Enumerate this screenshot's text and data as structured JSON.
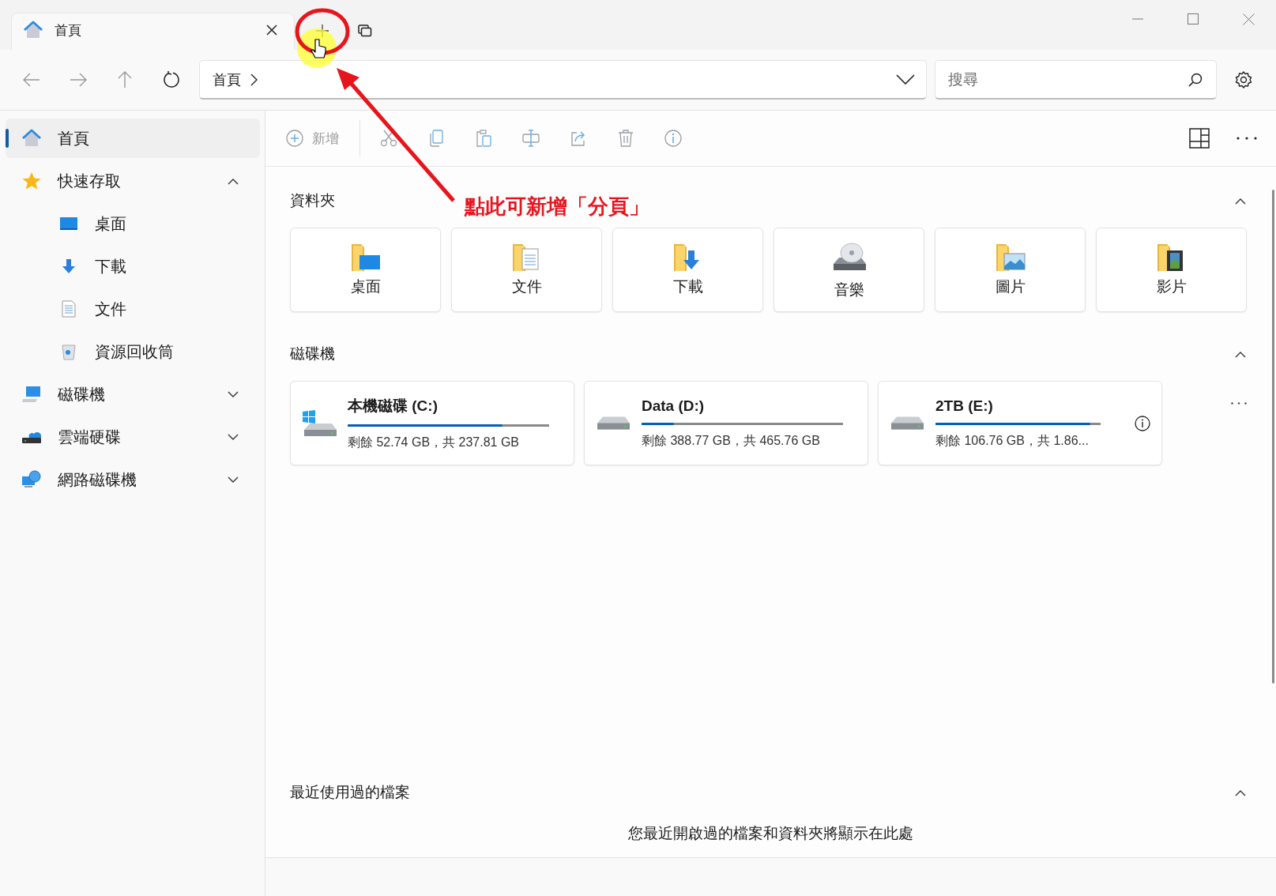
{
  "window": {
    "tabs": [
      {
        "label": "首頁",
        "selected": true
      }
    ]
  },
  "address_bar": {
    "breadcrumb": "首頁"
  },
  "search": {
    "placeholder": "搜尋"
  },
  "sidebar": {
    "items": [
      {
        "label": "首頁",
        "kind": "home",
        "selected": true
      },
      {
        "label": "快速存取",
        "kind": "star",
        "selected": false,
        "expanded": true,
        "children": [
          {
            "label": "桌面",
            "kind": "desktop",
            "selected": false
          },
          {
            "label": "下載",
            "kind": "download",
            "selected": false
          },
          {
            "label": "文件",
            "kind": "document",
            "selected": false
          },
          {
            "label": "資源回收筒",
            "kind": "recycle",
            "selected": false
          }
        ]
      },
      {
        "label": "磁碟機",
        "kind": "pc",
        "selected": false,
        "expanded": false
      },
      {
        "label": "雲端硬碟",
        "kind": "cloud",
        "selected": false,
        "expanded": false
      },
      {
        "label": "網路磁碟機",
        "kind": "network",
        "selected": false,
        "expanded": false
      }
    ]
  },
  "toolbar": {
    "new_label": "新增"
  },
  "folders": {
    "title": "資料夾",
    "expanded": true,
    "items": [
      {
        "label": "桌面",
        "kind": "desktop"
      },
      {
        "label": "文件",
        "kind": "documents"
      },
      {
        "label": "下載",
        "kind": "downloads"
      },
      {
        "label": "音樂",
        "kind": "music"
      },
      {
        "label": "圖片",
        "kind": "pictures"
      },
      {
        "label": "影片",
        "kind": "videos"
      }
    ]
  },
  "drives": {
    "title": "磁碟機",
    "expanded": true,
    "items": [
      {
        "name": "本機磁碟 (C:)",
        "kind": "system",
        "level": 0.77,
        "detail": "剩餘 52.74 GB，共 237.81 GB",
        "info": false
      },
      {
        "name": "Data (D:)",
        "kind": "disk",
        "level": 0.16,
        "detail": "剩餘 388.77 GB，共 465.76 GB",
        "info": false
      },
      {
        "name": "2TB (E:)",
        "kind": "disk",
        "level": 0.94,
        "detail": "剩餘 106.76 GB，共 1.86...",
        "info": true
      }
    ]
  },
  "recent": {
    "title": "最近使用過的檔案",
    "expanded": true,
    "empty_text": "您最近開啟過的檔案和資料夾將顯示在此處"
  },
  "annotation": {
    "text": "點此可新增「分頁」"
  }
}
